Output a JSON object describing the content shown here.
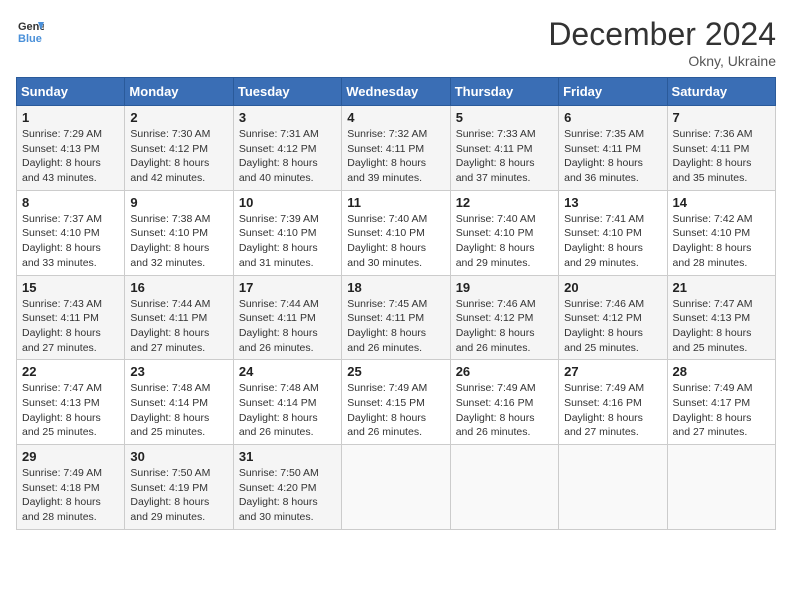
{
  "header": {
    "logo_line1": "General",
    "logo_line2": "Blue",
    "month_title": "December 2024",
    "location": "Okny, Ukraine"
  },
  "weekdays": [
    "Sunday",
    "Monday",
    "Tuesday",
    "Wednesday",
    "Thursday",
    "Friday",
    "Saturday"
  ],
  "weeks": [
    [
      {
        "day": "1",
        "sunrise": "7:29 AM",
        "sunset": "4:13 PM",
        "daylight": "8 hours and 43 minutes."
      },
      {
        "day": "2",
        "sunrise": "7:30 AM",
        "sunset": "4:12 PM",
        "daylight": "8 hours and 42 minutes."
      },
      {
        "day": "3",
        "sunrise": "7:31 AM",
        "sunset": "4:12 PM",
        "daylight": "8 hours and 40 minutes."
      },
      {
        "day": "4",
        "sunrise": "7:32 AM",
        "sunset": "4:11 PM",
        "daylight": "8 hours and 39 minutes."
      },
      {
        "day": "5",
        "sunrise": "7:33 AM",
        "sunset": "4:11 PM",
        "daylight": "8 hours and 37 minutes."
      },
      {
        "day": "6",
        "sunrise": "7:35 AM",
        "sunset": "4:11 PM",
        "daylight": "8 hours and 36 minutes."
      },
      {
        "day": "7",
        "sunrise": "7:36 AM",
        "sunset": "4:11 PM",
        "daylight": "8 hours and 35 minutes."
      }
    ],
    [
      {
        "day": "8",
        "sunrise": "7:37 AM",
        "sunset": "4:10 PM",
        "daylight": "8 hours and 33 minutes."
      },
      {
        "day": "9",
        "sunrise": "7:38 AM",
        "sunset": "4:10 PM",
        "daylight": "8 hours and 32 minutes."
      },
      {
        "day": "10",
        "sunrise": "7:39 AM",
        "sunset": "4:10 PM",
        "daylight": "8 hours and 31 minutes."
      },
      {
        "day": "11",
        "sunrise": "7:40 AM",
        "sunset": "4:10 PM",
        "daylight": "8 hours and 30 minutes."
      },
      {
        "day": "12",
        "sunrise": "7:40 AM",
        "sunset": "4:10 PM",
        "daylight": "8 hours and 29 minutes."
      },
      {
        "day": "13",
        "sunrise": "7:41 AM",
        "sunset": "4:10 PM",
        "daylight": "8 hours and 29 minutes."
      },
      {
        "day": "14",
        "sunrise": "7:42 AM",
        "sunset": "4:10 PM",
        "daylight": "8 hours and 28 minutes."
      }
    ],
    [
      {
        "day": "15",
        "sunrise": "7:43 AM",
        "sunset": "4:11 PM",
        "daylight": "8 hours and 27 minutes."
      },
      {
        "day": "16",
        "sunrise": "7:44 AM",
        "sunset": "4:11 PM",
        "daylight": "8 hours and 27 minutes."
      },
      {
        "day": "17",
        "sunrise": "7:44 AM",
        "sunset": "4:11 PM",
        "daylight": "8 hours and 26 minutes."
      },
      {
        "day": "18",
        "sunrise": "7:45 AM",
        "sunset": "4:11 PM",
        "daylight": "8 hours and 26 minutes."
      },
      {
        "day": "19",
        "sunrise": "7:46 AM",
        "sunset": "4:12 PM",
        "daylight": "8 hours and 26 minutes."
      },
      {
        "day": "20",
        "sunrise": "7:46 AM",
        "sunset": "4:12 PM",
        "daylight": "8 hours and 25 minutes."
      },
      {
        "day": "21",
        "sunrise": "7:47 AM",
        "sunset": "4:13 PM",
        "daylight": "8 hours and 25 minutes."
      }
    ],
    [
      {
        "day": "22",
        "sunrise": "7:47 AM",
        "sunset": "4:13 PM",
        "daylight": "8 hours and 25 minutes."
      },
      {
        "day": "23",
        "sunrise": "7:48 AM",
        "sunset": "4:14 PM",
        "daylight": "8 hours and 25 minutes."
      },
      {
        "day": "24",
        "sunrise": "7:48 AM",
        "sunset": "4:14 PM",
        "daylight": "8 hours and 26 minutes."
      },
      {
        "day": "25",
        "sunrise": "7:49 AM",
        "sunset": "4:15 PM",
        "daylight": "8 hours and 26 minutes."
      },
      {
        "day": "26",
        "sunrise": "7:49 AM",
        "sunset": "4:16 PM",
        "daylight": "8 hours and 26 minutes."
      },
      {
        "day": "27",
        "sunrise": "7:49 AM",
        "sunset": "4:16 PM",
        "daylight": "8 hours and 27 minutes."
      },
      {
        "day": "28",
        "sunrise": "7:49 AM",
        "sunset": "4:17 PM",
        "daylight": "8 hours and 27 minutes."
      }
    ],
    [
      {
        "day": "29",
        "sunrise": "7:49 AM",
        "sunset": "4:18 PM",
        "daylight": "8 hours and 28 minutes."
      },
      {
        "day": "30",
        "sunrise": "7:50 AM",
        "sunset": "4:19 PM",
        "daylight": "8 hours and 29 minutes."
      },
      {
        "day": "31",
        "sunrise": "7:50 AM",
        "sunset": "4:20 PM",
        "daylight": "8 hours and 30 minutes."
      },
      null,
      null,
      null,
      null
    ]
  ]
}
